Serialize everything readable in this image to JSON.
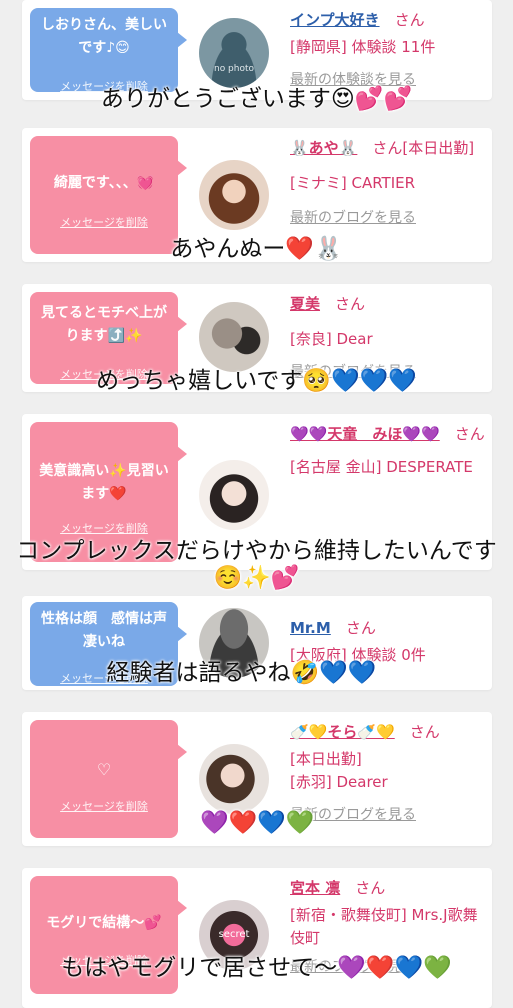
{
  "common": {
    "delete_label": "メッセージを削除",
    "san": "さん"
  },
  "cards": [
    {
      "message": "しおりさん、美しいです♪😊",
      "bubble": "blue",
      "avatar": "no-photo",
      "avatar_text": "no photo",
      "name": "インプ大好き",
      "name_extra": "",
      "details": [
        "[静岡県] 体験談 11件"
      ],
      "link": "最新の体験談を見る"
    },
    {
      "message": "綺麗です、、、💓",
      "bubble": "pink",
      "avatar": "woman",
      "name": "🐰あや🐰",
      "name_extra": "[本日出勤]",
      "details": [
        "[ミナミ] CARTIER"
      ],
      "link": "最新のブログを見る"
    },
    {
      "message": "見てるとモチベ上がります⤴️✨",
      "bubble": "pink",
      "avatar": "pet",
      "name": "夏美",
      "name_extra": "",
      "details": [
        "[奈良] Dear"
      ],
      "link": "最新のブログを見る"
    },
    {
      "message": "美意識高い✨見習います❤️",
      "bubble": "pink",
      "avatar": "woman",
      "name": "💜💜天童　みほ💜💜",
      "name_extra": "",
      "details": [
        "[名古屋 金山] DESPERATE"
      ],
      "link": ""
    },
    {
      "message": "性格は顔　感情は声　凄いね",
      "bubble": "blue",
      "avatar": "man",
      "name": "Mr.M",
      "name_extra": "",
      "details": [
        "[大阪府] 体験談 0件"
      ],
      "link": ""
    },
    {
      "message": "♡",
      "bubble": "pink",
      "avatar": "woman",
      "name": "🍼💛そら🍼💛",
      "name_extra": "",
      "details": [
        "[本日出勤]",
        "[赤羽] Dearer"
      ],
      "link": "最新のブログを見る"
    },
    {
      "message": "モグリで結構〜💕",
      "bubble": "pink",
      "avatar": "secret",
      "avatar_text": "secret",
      "name": "宮本 凛",
      "name_extra": "",
      "details": [
        "[新宿・歌舞伎町] Mrs.J歌舞伎町"
      ],
      "link": "最新のブログを見る"
    }
  ],
  "overlays": [
    "ありがとうございます😍💕💕",
    "あやんぬー❤️🐰",
    "めっちゃ嬉しいです🥺💙💙💙",
    "コンプレックスだらけやから維持したいんです☺️✨💕",
    "経験者は語るやね🤣💙💙",
    "💜❤️💙💚",
    "もはやモグリで居させて〜💜❤️💙💚"
  ]
}
